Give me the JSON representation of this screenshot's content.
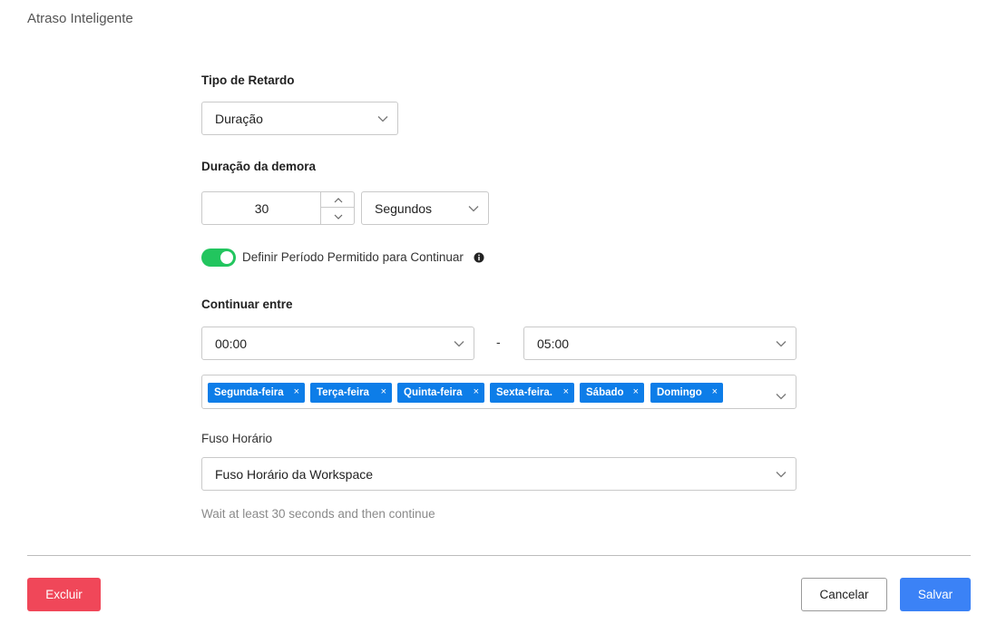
{
  "header": {
    "title": "Atraso Inteligente"
  },
  "delay_type": {
    "label": "Tipo de Retardo",
    "value": "Duração",
    "icon": "chevron-down-icon"
  },
  "delay_duration": {
    "label": "Duração da demora",
    "amount": "30",
    "unit": "Segundos"
  },
  "allowed_period": {
    "toggle_on": true,
    "label": "Definir Período Permitido para Continuar",
    "info_icon": "info-icon",
    "toggle_color": "#22c55e"
  },
  "continue_between": {
    "label": "Continuar entre",
    "start_time": "00:00",
    "separator": "-",
    "end_time": "05:00",
    "days": [
      {
        "label": "Segunda-feira",
        "remove": "×"
      },
      {
        "label": "Terça-feira",
        "remove": "×"
      },
      {
        "label": "Quinta-feira",
        "remove": "×"
      },
      {
        "label": "Sexta-feira.",
        "remove": "×"
      },
      {
        "label": "Sábado",
        "remove": "×"
      },
      {
        "label": "Domingo",
        "remove": "×"
      }
    ],
    "tag_color": "#0d7de8"
  },
  "timezone": {
    "label": "Fuso Horário",
    "value": "Fuso Horário da Workspace"
  },
  "summary": "Wait at least 30 seconds and then continue",
  "footer": {
    "delete_label": "Excluir",
    "cancel_label": "Cancelar",
    "save_label": "Salvar",
    "delete_color": "#f04759",
    "save_color": "#3b82f6"
  }
}
